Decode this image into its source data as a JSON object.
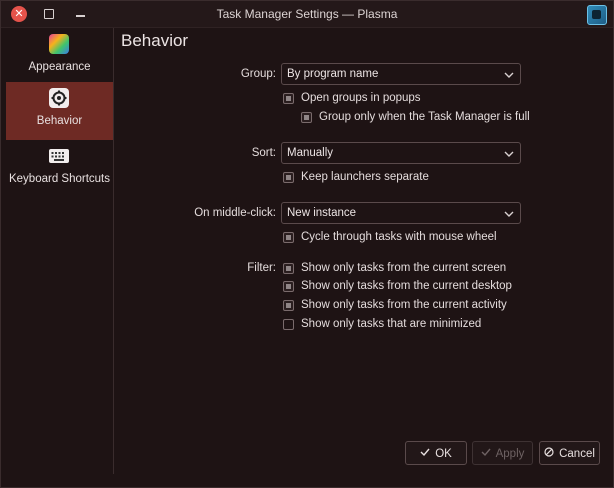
{
  "window": {
    "title": "Task Manager Settings — Plasma"
  },
  "sidebar": {
    "items": [
      {
        "label": "Appearance",
        "icon": "palette-icon"
      },
      {
        "label": "Behavior",
        "icon": "gear-icon"
      },
      {
        "label": "Keyboard Shortcuts",
        "icon": "keyboard-icon"
      }
    ]
  },
  "page": {
    "title": "Behavior"
  },
  "group": {
    "label": "Group:",
    "value": "By program name",
    "options": [
      {
        "label": "Open groups in popups",
        "checked": true
      },
      {
        "label": "Group only when the Task Manager is full",
        "checked": true
      }
    ]
  },
  "sort": {
    "label": "Sort:",
    "value": "Manually",
    "options": [
      {
        "label": "Keep launchers separate",
        "checked": true
      }
    ]
  },
  "middle_click": {
    "label": "On middle-click:",
    "value": "New instance",
    "options": [
      {
        "label": "Cycle through tasks with mouse wheel",
        "checked": true
      }
    ]
  },
  "filter": {
    "label": "Filter:",
    "options": [
      {
        "label": "Show only tasks from the current screen",
        "checked": true
      },
      {
        "label": "Show only tasks from the current desktop",
        "checked": true
      },
      {
        "label": "Show only tasks from the current activity",
        "checked": true
      },
      {
        "label": "Show only tasks that are minimized",
        "checked": false
      }
    ]
  },
  "buttons": {
    "ok": "OK",
    "apply": "Apply",
    "cancel": "Cancel"
  },
  "colors": {
    "accent": "#6e2a24",
    "close": "#e5534b"
  }
}
